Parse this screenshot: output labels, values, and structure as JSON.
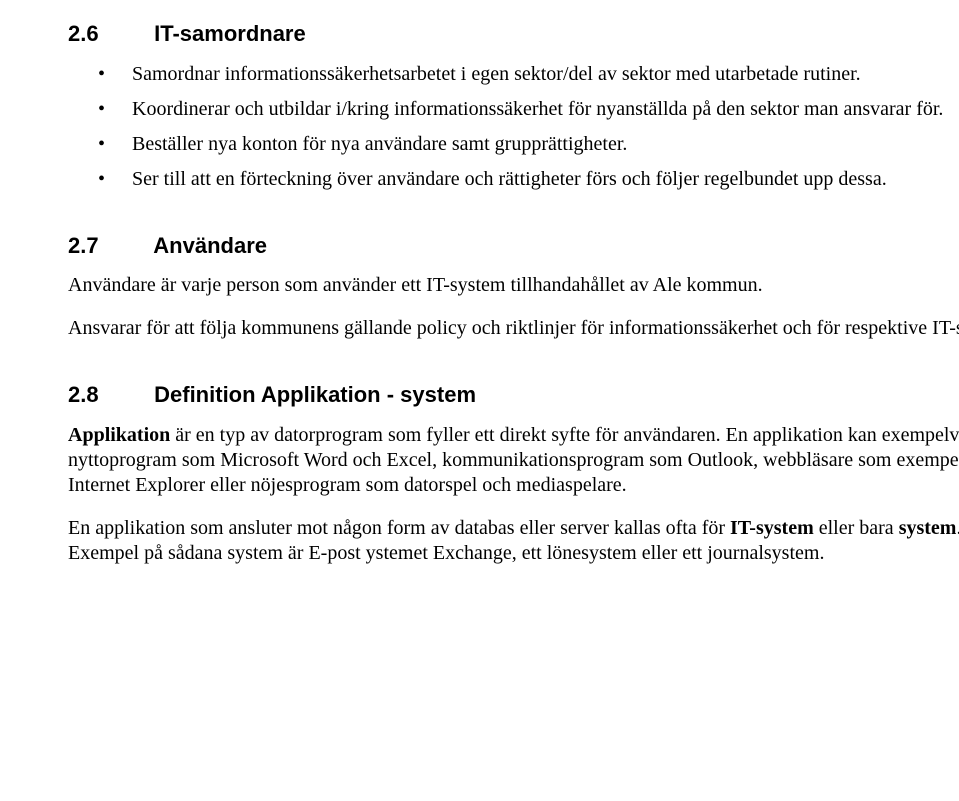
{
  "sections": [
    {
      "number": "2.6",
      "title": "IT-samordnare",
      "bullets": [
        "Samordnar informationssäkerhetsarbetet i egen sektor/del av sektor med utarbetade rutiner.",
        "Koordinerar och utbildar i/kring informationssäkerhet för nyanställda på den sektor man ansvarar för.",
        "Beställer nya konton för nya användare samt grupprättigheter.",
        "Ser till att en förteckning över användare och rättigheter förs och följer regelbundet upp dessa."
      ]
    },
    {
      "number": "2.7",
      "title": "Användare",
      "paragraphs": [
        "Användare är varje person som använder ett IT-system tillhandahållet av Ale kommun.",
        "Ansvarar för att följa kommunens gällande policy och riktlinjer för informationssäkerhet och för respektive IT-system."
      ]
    },
    {
      "number": "2.8",
      "title": "Definition Applikation - system",
      "rich_paragraphs": [
        {
          "runs": [
            {
              "text": "Applikation",
              "bold": true
            },
            {
              "text": " är en typ av datorprogram som fyller ett direkt syfte för användaren. En applikation kan exempelvis vara nyttoprogram som Microsoft Word och Excel, kommunikationsprogram som Outlook, webbläsare som exempelvis Internet Explorer eller nöjesprogram som datorspel och mediaspelare."
            }
          ]
        },
        {
          "runs": [
            {
              "text": "En applikation som ansluter mot någon form av databas eller server kallas ofta för "
            },
            {
              "text": "IT-system",
              "bold": true
            },
            {
              "text": " eller bara "
            },
            {
              "text": "system",
              "bold": true
            },
            {
              "text": ". Exempel på sådana system är E-post ystemet Exchange, ett lönesystem eller ett journalsystem."
            }
          ]
        }
      ]
    }
  ]
}
